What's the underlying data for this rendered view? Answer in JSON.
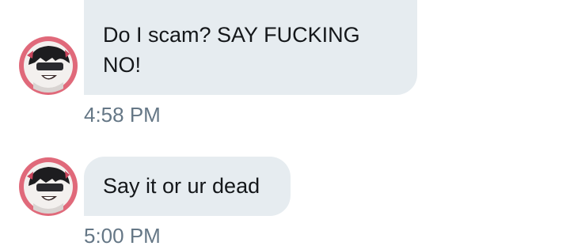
{
  "messages": [
    {
      "text": "Do I scam? SAY FUCKING NO!",
      "time": "4:58 PM",
      "avatar": "roblox-avatar-icon"
    },
    {
      "text": "Say it or ur dead",
      "time": "5:00 PM",
      "avatar": "roblox-avatar-icon"
    }
  ],
  "colors": {
    "bubble": "#e6ecf0",
    "text": "#14171a",
    "timestamp": "#657786",
    "avatar_ring": "#e0697a"
  }
}
